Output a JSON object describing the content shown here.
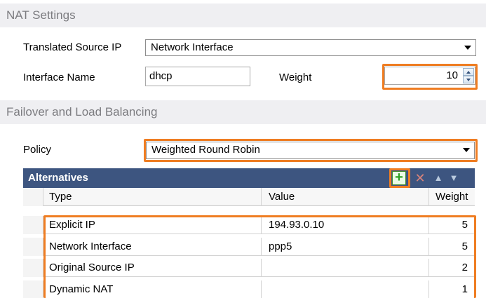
{
  "nat_settings": {
    "section_title": "NAT Settings",
    "translated_source_ip_label": "Translated Source IP",
    "translated_source_ip_value": "Network Interface",
    "interface_name_label": "Interface Name",
    "interface_name_value": "dhcp",
    "weight_label": "Weight",
    "weight_value": "10"
  },
  "failover": {
    "section_title": "Failover and Load Balancing",
    "policy_label": "Policy",
    "policy_value": "Weighted Round Robin"
  },
  "alternatives": {
    "title": "Alternatives",
    "toolbar": {
      "add_icon": "add-icon",
      "delete_icon": "delete-icon",
      "move_up_icon": "arrow-up-icon",
      "move_down_icon": "arrow-down-icon"
    },
    "columns": [
      "Type",
      "Value",
      "Weight"
    ],
    "rows": [
      {
        "type": "Explicit IP",
        "value": "194.93.0.10",
        "weight": "5"
      },
      {
        "type": "Network Interface",
        "value": "ppp5",
        "weight": "5"
      },
      {
        "type": "Original Source IP",
        "value": "",
        "weight": "2"
      },
      {
        "type": "Dynamic NAT",
        "value": "",
        "weight": "1"
      }
    ]
  },
  "colors": {
    "highlight": "#ef7d22",
    "header_bar": "#3d5580",
    "section_bg": "#efeff2"
  }
}
